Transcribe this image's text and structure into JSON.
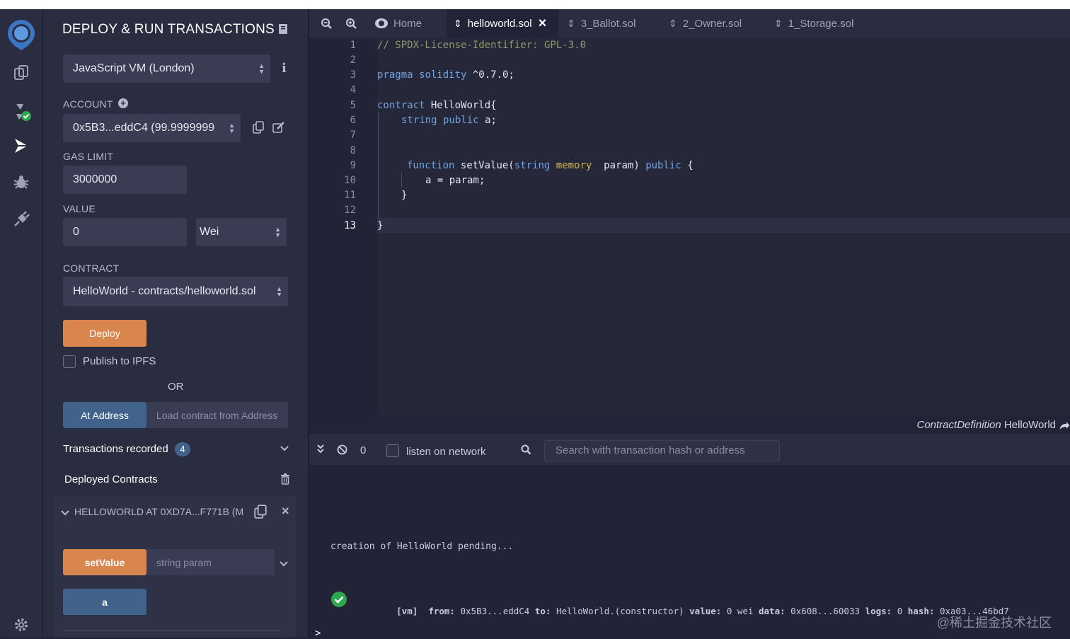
{
  "panel": {
    "title": "DEPLOY & RUN TRANSACTIONS",
    "environment": "JavaScript VM (London)",
    "account_label": "ACCOUNT",
    "account_value": "0x5B3...eddC4 (99.9999999",
    "gas_limit_label": "GAS LIMIT",
    "gas_limit_value": "3000000",
    "value_label": "VALUE",
    "value_amount": "0",
    "value_unit": "Wei",
    "contract_label": "CONTRACT",
    "contract_value": "HelloWorld - contracts/helloworld.sol",
    "deploy_label": "Deploy",
    "publish_label": "Publish to IPFS",
    "or_label": "OR",
    "at_address_label": "At Address",
    "at_address_placeholder": "Load contract from Address",
    "transactions_label": "Transactions recorded",
    "transactions_count": "4",
    "deployed_label": "Deployed Contracts",
    "instance_label": "HELLOWORLD AT 0XD7A...F771B (M",
    "setvalue_label": "setValue",
    "setvalue_placeholder": "string param",
    "a_label": "a"
  },
  "tabs": [
    {
      "label": "Home"
    },
    {
      "label": "helloworld.sol"
    },
    {
      "label": "3_Ballot.sol"
    },
    {
      "label": "2_Owner.sol"
    },
    {
      "label": "1_Storage.sol"
    }
  ],
  "line_numbers": [
    "1",
    "2",
    "3",
    "4",
    "5",
    "6",
    "7",
    "8",
    "9",
    "10",
    "11",
    "12",
    "13"
  ],
  "code": {
    "line1": "// SPDX-License-Identifier: GPL-3.0",
    "line3_kw1": "pragma",
    "line3_kw2": "solidity",
    "line3_rest": " ^0.7.0;",
    "line5_kw": "contract",
    "line5_rest": " HelloWorld{",
    "line6_kw1": "string",
    "line6_kw2": "public",
    "line6_rest": " a;",
    "line9_kw1": "function",
    "line9_mid": " setValue(",
    "line9_kw2": "string",
    "line9_mem": "memory",
    "line9_param": "  param)",
    "line9_kw3": "public",
    "line9_end": " {",
    "line10": "a = param;",
    "line11": "}",
    "line13": "}"
  },
  "status": {
    "definition_prefix": "ContractDefinition",
    "definition_name": "HelloWorld"
  },
  "terminal": {
    "pending_count": "0",
    "listen_label": "listen on network",
    "search_placeholder": "Search with transaction hash or address",
    "creation_text": "creation of HelloWorld pending...",
    "tx_vm": "[vm]",
    "tx_from_label": "from:",
    "tx_from": "0x5B3...eddC4",
    "tx_to_label": "to:",
    "tx_to": "HelloWorld.(constructor)",
    "tx_value_label": "value:",
    "tx_value": "0 wei",
    "tx_data_label": "data:",
    "tx_data": "0x608...60033",
    "tx_logs_label": "logs:",
    "tx_logs": "0",
    "tx_hash_label": "hash:",
    "tx_hash": "0xa03...46bd7",
    "prompt": ">"
  },
  "watermark": "@稀土掘金技术社区",
  "colors": {
    "accent_orange": "#d8854e",
    "accent_blue": "#41628a",
    "success_green": "#2ea84c",
    "background": "#222336",
    "panel": "#2a2c3f"
  }
}
